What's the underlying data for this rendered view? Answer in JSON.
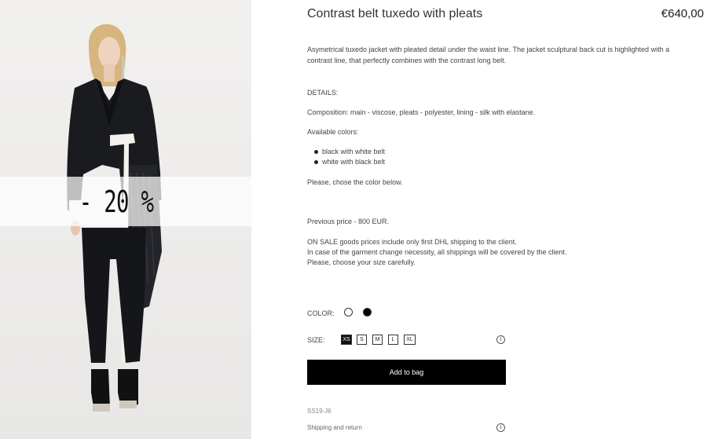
{
  "product": {
    "title": "Contrast belt tuxedo with pleats",
    "price": "€640,00",
    "description": "Asymetrical tuxedo jacket with pleated detail under the waist line. The jacket sculptural back cut is highlighted with a contrast line, that perfectly combines with the contrast long belt.",
    "details_heading": "DETAILS:",
    "composition": "Composition: main - viscose, pleats - polyester, lining - silk with elastane.",
    "available_colors_label": "Available colors:",
    "colors_list": [
      "black with white belt",
      "white with black belt"
    ],
    "chose_color_note": "Please, chose the color below.",
    "previous_price": "Previous price - 800 EUR.",
    "sale_notes": [
      "ON SALE goods prices include only first DHL shipping to the client.",
      "In case of the garment change necessity, all shippings will be covered by the client.",
      "Please, choose your size carefully."
    ],
    "sku": "SS19-J6"
  },
  "image": {
    "sale_badge": "- 20 %"
  },
  "options": {
    "color_label": "COLOR:",
    "color_swatches": [
      {
        "name": "white",
        "hex": "#ffffff",
        "selected": false
      },
      {
        "name": "black",
        "hex": "#000000",
        "selected": true
      }
    ],
    "size_label": "SIZE:",
    "sizes": [
      "XS",
      "S",
      "M",
      "L",
      "XL"
    ],
    "selected_size": "XS",
    "size_info_icon": "info-icon"
  },
  "actions": {
    "add_to_bag": "Add to bag",
    "shipping_link": "Shipping and return",
    "shipping_info_icon": "info-icon"
  },
  "colors": {
    "button_bg": "#000000",
    "button_text": "#ffffff",
    "text": "#444444"
  }
}
